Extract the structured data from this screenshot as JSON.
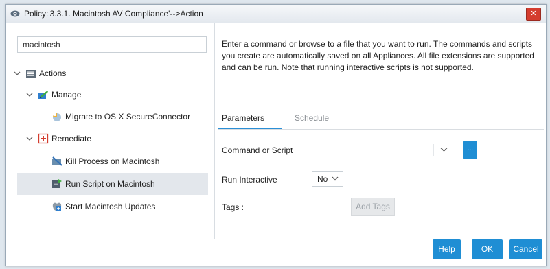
{
  "window": {
    "title": "Policy:'3.3.1. Macintosh AV Compliance'-->Action",
    "close_label": "✕"
  },
  "left": {
    "search_value": "macintosh",
    "tree": {
      "actions_label": "Actions",
      "manage_label": "Manage",
      "migrate_label": "Migrate to OS X SecureConnector",
      "remediate_label": "Remediate",
      "kill_label": "Kill Process on Macintosh",
      "run_label": "Run Script on Macintosh",
      "updates_label": "Start Macintosh Updates"
    }
  },
  "right": {
    "description": "Enter a command or browse to a file that you want to run. The commands and scripts you create are automatically saved on all Appliances. All file extensions are supported and can be run. Note that running interactive scripts is not supported.",
    "tabs": {
      "parameters": "Parameters",
      "schedule": "Schedule"
    },
    "command_label": "Command or Script",
    "command_value": "",
    "browse_label": "...",
    "interactive_label": "Run Interactive",
    "interactive_value": "No",
    "tags_label": "Tags :",
    "add_tags_label": "Add Tags"
  },
  "footer": {
    "help": "Help",
    "ok": "OK",
    "cancel": "Cancel"
  },
  "colors": {
    "accent": "#1f8ed4",
    "close": "#d43c2e",
    "selected_row": "#e3e7ec"
  },
  "icons": [
    "app-logo-icon",
    "close-icon",
    "actions-list-icon",
    "manage-icon",
    "migrate-icon",
    "remediate-icon",
    "kill-process-icon",
    "run-script-icon",
    "updates-icon",
    "chevron-down-icon"
  ]
}
